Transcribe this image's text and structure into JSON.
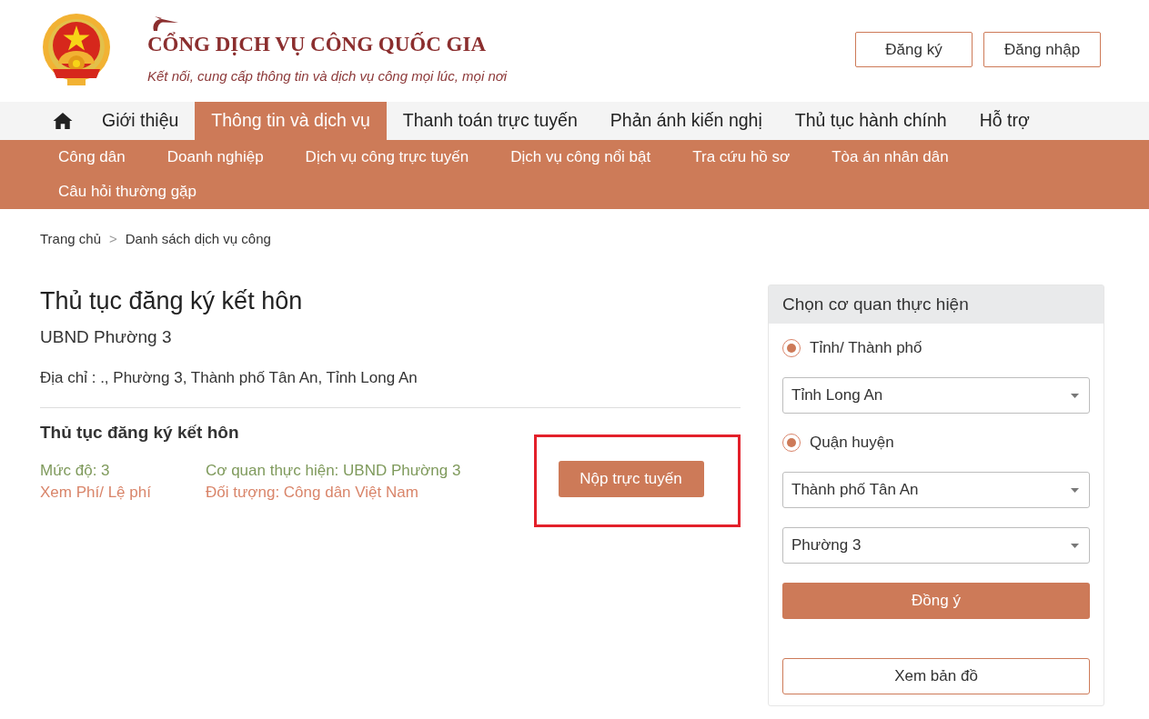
{
  "header": {
    "site_title": "CỔNG DỊCH VỤ CÔNG QUỐC GIA",
    "tagline": "Kết nối, cung cấp thông tin và dịch vụ công mọi lúc, mọi nơi",
    "buttons": [
      "Đăng ký",
      "Đăng nhập"
    ]
  },
  "main_nav": [
    {
      "kind": "home",
      "selected": false
    },
    {
      "kind": "link",
      "label": "Giới thiệu",
      "selected": false
    },
    {
      "kind": "link",
      "label": "Thông tin và dịch vụ",
      "selected": true
    },
    {
      "kind": "link",
      "label": "Thanh toán trực tuyến",
      "selected": false
    },
    {
      "kind": "link",
      "label": "Phản ánh kiến nghị",
      "selected": false
    },
    {
      "kind": "link",
      "label": "Thủ tục hành chính",
      "selected": false
    },
    {
      "kind": "link",
      "label": "Hỗ trợ",
      "selected": false
    }
  ],
  "sub_nav": [
    "Công dân",
    "Doanh nghiệp",
    "Dịch vụ công trực tuyến",
    "Dịch vụ công nổi bật",
    "Tra cứu hồ sơ",
    "Tòa án nhân dân",
    "Câu hỏi thường gặp"
  ],
  "breadcrumb": {
    "items": [
      "Trang chủ",
      "Danh sách dịch vụ công"
    ],
    "separator": ">"
  },
  "procedure": {
    "title": "Thủ tục đăng ký kết hôn",
    "agency": "UBND Phường 3",
    "address": "Địa chỉ : ., Phường 3, Thành phố Tân An, Tỉnh Long An",
    "service_name": "Thủ tục đăng ký kết hôn",
    "details": [
      {
        "kind": "info",
        "text": "Mức độ: 3"
      },
      {
        "kind": "info",
        "text": "Cơ quan thực hiện: UBND Phường 3"
      },
      {
        "kind": "link",
        "text": "Xem Phí/ Lệ phí"
      },
      {
        "kind": "link",
        "text": "Đối tượng: Công dân Việt Nam"
      }
    ],
    "submit_button": {
      "label": "Nộp trực tuyến",
      "highlighted": true
    }
  },
  "agency_panel": {
    "title": "Chọn cơ quan thực hiện",
    "fields": [
      {
        "kind": "radio",
        "label": "Tỉnh/ Thành phố",
        "checked": true
      },
      {
        "kind": "select",
        "value": "Tỉnh Long An"
      },
      {
        "kind": "radio",
        "label": "Quận huyện",
        "checked": true
      },
      {
        "kind": "select",
        "value": "Thành phố Tân An"
      },
      {
        "kind": "select",
        "value": "Phường 3"
      }
    ],
    "confirm_button": "Đồng ý",
    "map_button": "Xem bản đồ"
  }
}
